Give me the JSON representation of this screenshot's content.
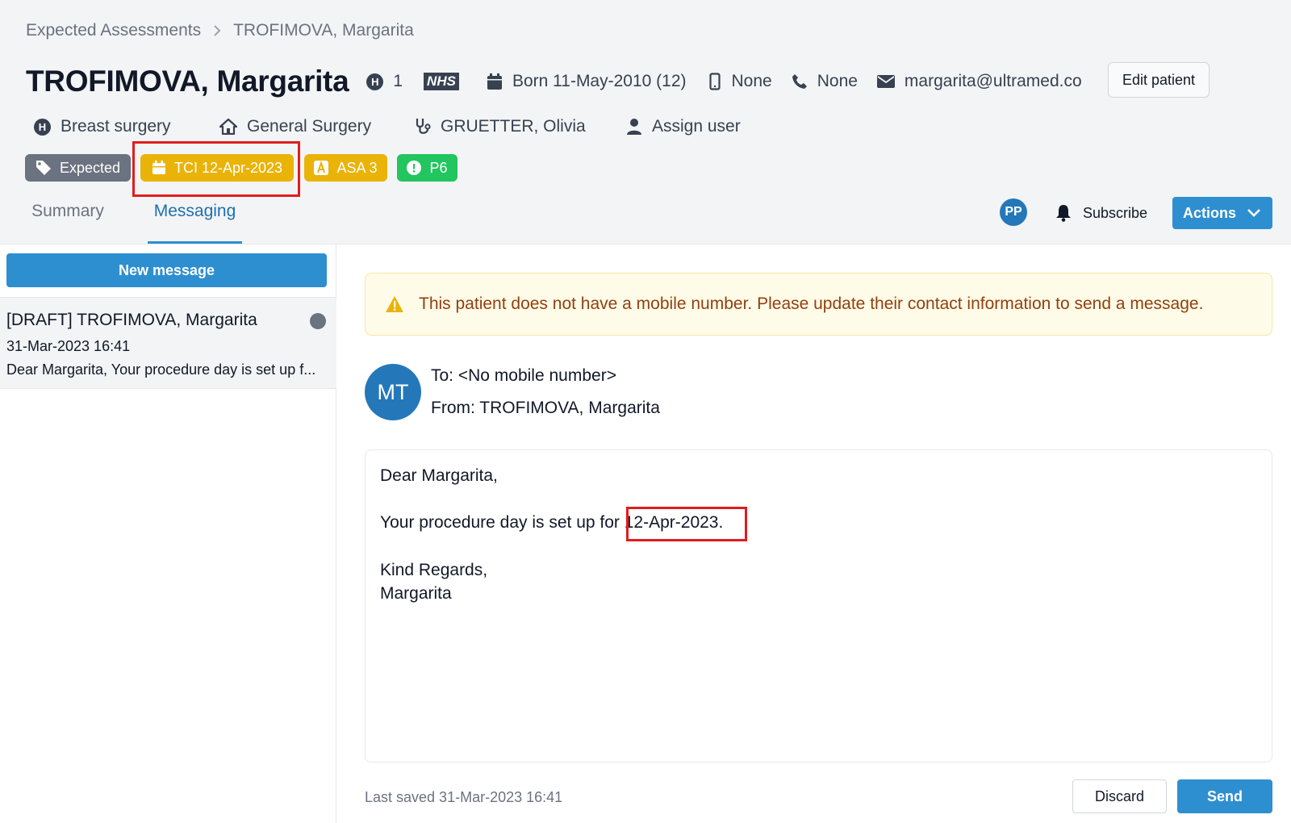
{
  "breadcrumb": {
    "parent": "Expected Assessments",
    "separator": ">",
    "current": "TROFIMOVA, Margarita"
  },
  "patient": {
    "name": "TROFIMOVA, Margarita",
    "hospital_number": "1",
    "nhs_label": "NHS",
    "born": "Born 11-May-2010 (12)",
    "mobile": "None",
    "phone": "None",
    "email": "margarita@ultramed.co",
    "edit_label": "Edit patient"
  },
  "info": {
    "specialty": "Breast surgery",
    "department": "General Surgery",
    "clinician": "GRUETTER, Olivia",
    "assign": "Assign user"
  },
  "tags": [
    {
      "label": "Expected",
      "icon": "tag-icon",
      "color": "#6b7280"
    },
    {
      "label": "TCI 12-Apr-2023",
      "icon": "calendar-icon",
      "color": "#eab308"
    },
    {
      "label": "ASA 3",
      "icon": "asa-icon",
      "color": "#eab308"
    },
    {
      "label": "P6",
      "icon": "alert-circle-icon",
      "color": "#22c55e"
    }
  ],
  "tabs": [
    {
      "label": "Summary",
      "active": false
    },
    {
      "label": "Messaging",
      "active": true
    }
  ],
  "toolbar": {
    "avatar_initials": "PP",
    "subscribe_label": "Subscribe",
    "actions_label": "Actions"
  },
  "sidebar": {
    "new_message_label": "New message",
    "messages": [
      {
        "title": "[DRAFT] TROFIMOVA, Margarita",
        "date": "31-Mar-2023 16:41",
        "preview": "Dear Margarita, Your procedure day is set up f..."
      }
    ]
  },
  "warning": {
    "text": "This patient does not have a mobile number. Please update their contact information to send a message."
  },
  "message": {
    "avatar_initials": "MT",
    "to": "To: <No mobile number>",
    "from": "From: TROFIMOVA, Margarita",
    "greeting": "Dear Margarita,",
    "body_prefix": "Your procedure day is set up for ",
    "body_date": "12-Apr-2023.",
    "closing": "Kind Regards,",
    "signature": "Margarita"
  },
  "footer": {
    "last_saved": "Last saved 31-Mar-2023 16:41",
    "discard_label": "Discard",
    "send_label": "Send"
  },
  "colors": {
    "accent": "#2e8fd0",
    "highlight_box": "#e11d1d",
    "warning_text": "#92400e"
  }
}
